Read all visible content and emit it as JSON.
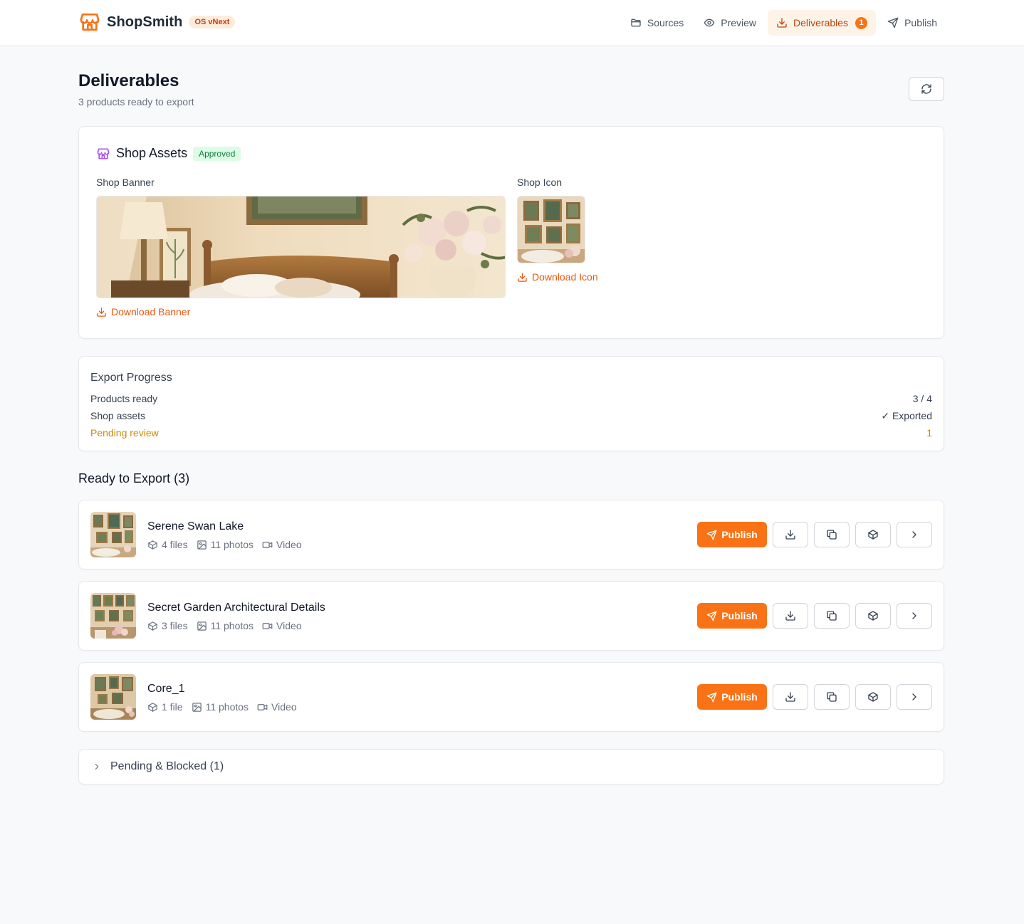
{
  "app": {
    "name": "ShopSmith",
    "badge": "OS vNext"
  },
  "nav": {
    "sources": "Sources",
    "preview": "Preview",
    "deliverables": "Deliverables",
    "deliverables_count": "1",
    "publish": "Publish"
  },
  "page": {
    "title": "Deliverables",
    "subtitle": "3 products ready to export"
  },
  "shop_assets": {
    "title": "Shop Assets",
    "status": "Approved",
    "banner_label": "Shop Banner",
    "icon_label": "Shop Icon",
    "download_banner": "Download Banner",
    "download_icon": "Download Icon"
  },
  "export_progress": {
    "title": "Export Progress",
    "rows": [
      {
        "label": "Products ready",
        "value": "3 / 4"
      },
      {
        "label": "Shop assets",
        "value": "✓ Exported"
      },
      {
        "label": "Pending review",
        "value": "1"
      }
    ]
  },
  "ready": {
    "title": "Ready to Export (3)",
    "publish_label": "Publish",
    "products": [
      {
        "name": "Serene Swan Lake",
        "files": "4 files",
        "photos": "11 photos",
        "video": "Video"
      },
      {
        "name": "Secret Garden Architectural Details",
        "files": "3 files",
        "photos": "11 photos",
        "video": "Video"
      },
      {
        "name": "Core_1",
        "files": "1 file",
        "photos": "11 photos",
        "video": "Video"
      }
    ]
  },
  "pending": {
    "title": "Pending & Blocked (1)"
  },
  "colors": {
    "accent": "#f97316",
    "accent_text": "#ea580c",
    "approved_bg": "#dcfce7",
    "approved_text": "#15803d",
    "pending_text": "#ca8a04"
  }
}
